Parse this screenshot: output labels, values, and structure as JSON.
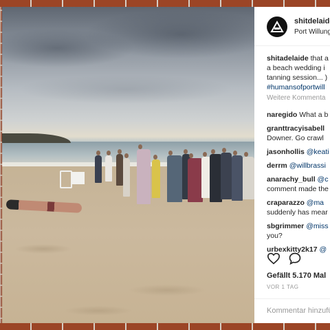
{
  "post": {
    "username": "shitdelaide",
    "location": "Port Willunga",
    "caption_user": "shitadelaide",
    "caption_text": "that a beach wedding i tanning session... Downer. Go crawl",
    "caption_line1": "that a",
    "caption_line2": "a beach wedding i",
    "caption_line3": "tanning session... )",
    "hashtag": "#humansofportwill",
    "more_comments": "Weitere Kommenta",
    "likes": "Gefällt 5.170 Mal",
    "time_ago": "VOR 1 TAG",
    "add_comment_placeholder": "Kommentar hinzufü"
  },
  "comments": [
    {
      "user": "naregido",
      "text": "What a b",
      "mention": ""
    },
    {
      "user": "granttracyisabell",
      "text": "Downer. Go crawl",
      "mention": ""
    },
    {
      "user": "jasonhollis",
      "text": "",
      "mention": "@keati"
    },
    {
      "user": "derrm",
      "text": "",
      "mention": "@willbrassi"
    },
    {
      "user": "anarachy_bull",
      "text": "comment made the",
      "mention": "@c"
    },
    {
      "user": "craparazzo",
      "text": "suddenly has mear",
      "mention": "@ma"
    },
    {
      "user": "sbgrimmer",
      "text": "you?",
      "mention": "@miss"
    },
    {
      "user": "urbexkitty2k17",
      "text": "",
      "mention": "@"
    }
  ],
  "icons": {
    "like": "heart-icon",
    "comment": "comment-bubble-icon",
    "avatar": "avatar-logo"
  },
  "colors": {
    "link": "#003569",
    "text": "#262626",
    "muted": "#999999"
  }
}
